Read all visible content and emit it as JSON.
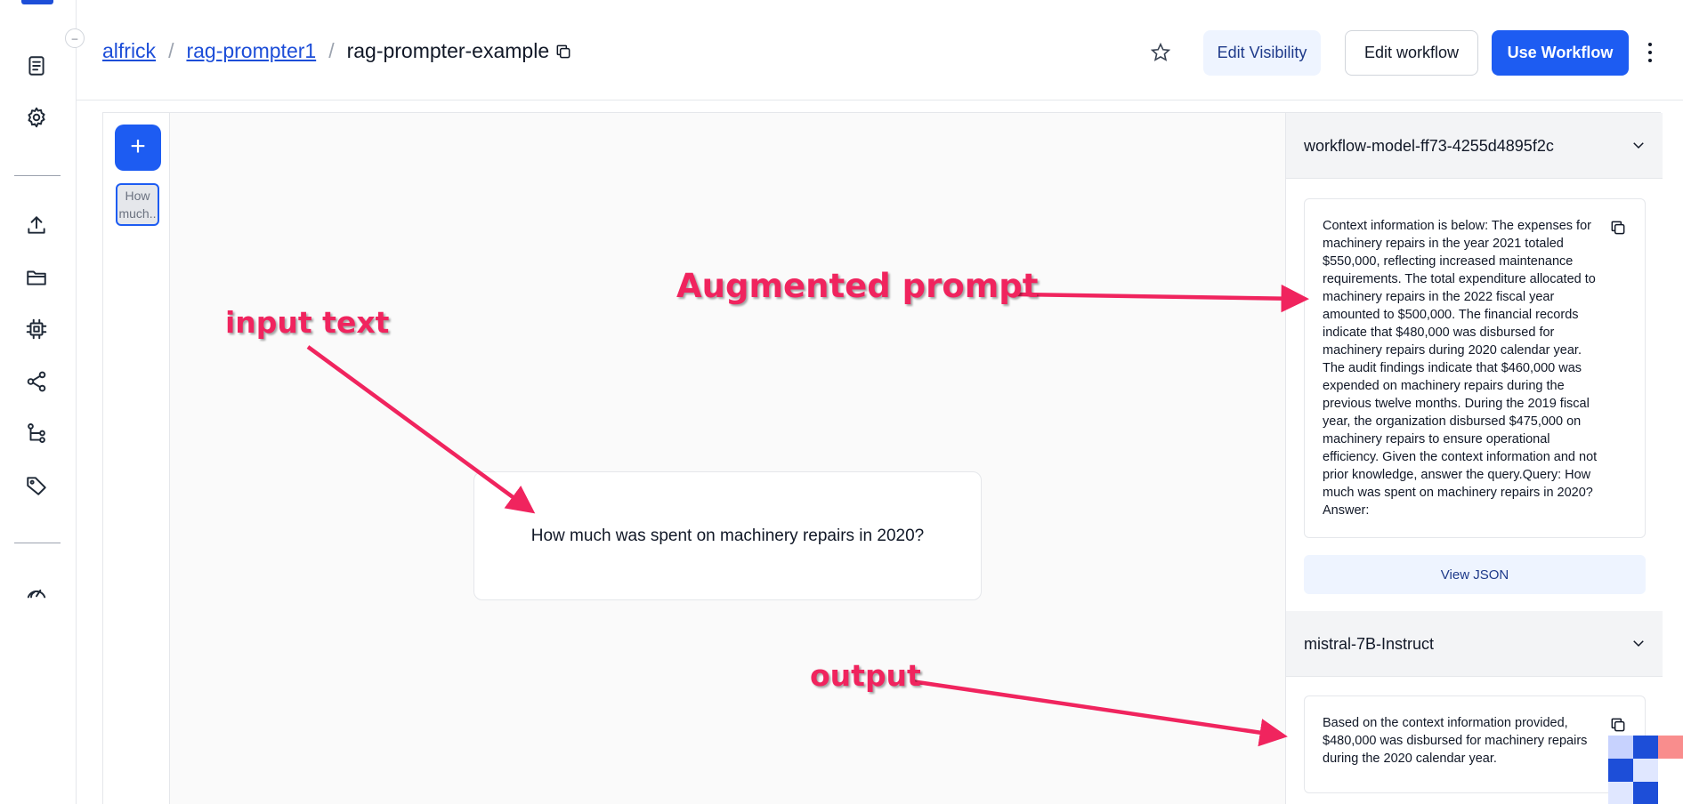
{
  "breadcrumb": {
    "user": "alfrick",
    "app": "rag-prompter1",
    "workflow": "rag-prompter-example"
  },
  "header": {
    "edit_visibility": "Edit Visibility",
    "edit_workflow": "Edit workflow",
    "use_workflow": "Use Workflow"
  },
  "sidebar": {
    "icons": [
      "document-icon",
      "settings-icon",
      "upload-icon",
      "folder-icon",
      "cpu-icon",
      "share-icon",
      "workflow-icon",
      "tag-icon",
      "gauge-icon"
    ]
  },
  "inputs": {
    "thumbnail_text": "How much..",
    "input_text": "How much was spent on machinery repairs in 2020?"
  },
  "results": {
    "node1": {
      "name": "workflow-model-ff73-4255d4895f2c",
      "output": "Context information is below: The expenses for machinery repairs in the year 2021 totaled $550,000, reflecting increased maintenance requirements. The total expenditure allocated to machinery repairs in the 2022 fiscal year amounted to $500,000. The financial records indicate that $480,000 was disbursed for machinery repairs during 2020 calendar year. The audit findings indicate that $460,000 was expended on machinery repairs during the previous twelve months. During the 2019 fiscal year, the organization disbursed $475,000 on machinery repairs to ensure operational efficiency. Given the context information and not prior knowledge, answer the query.Query: How much was spent on machinery repairs in 2020? Answer:",
      "view_json": "View JSON"
    },
    "node2": {
      "name": "mistral-7B-Instruct",
      "output": "Based on the context information provided, $480,000 was disbursed for machinery repairs during the 2020 calendar year."
    }
  },
  "annotations": {
    "augmented": "Augmented prompt",
    "input": "input text",
    "output": "output"
  },
  "colors": {
    "accent": "#1d5cf2",
    "annotation": "#f0245e"
  }
}
